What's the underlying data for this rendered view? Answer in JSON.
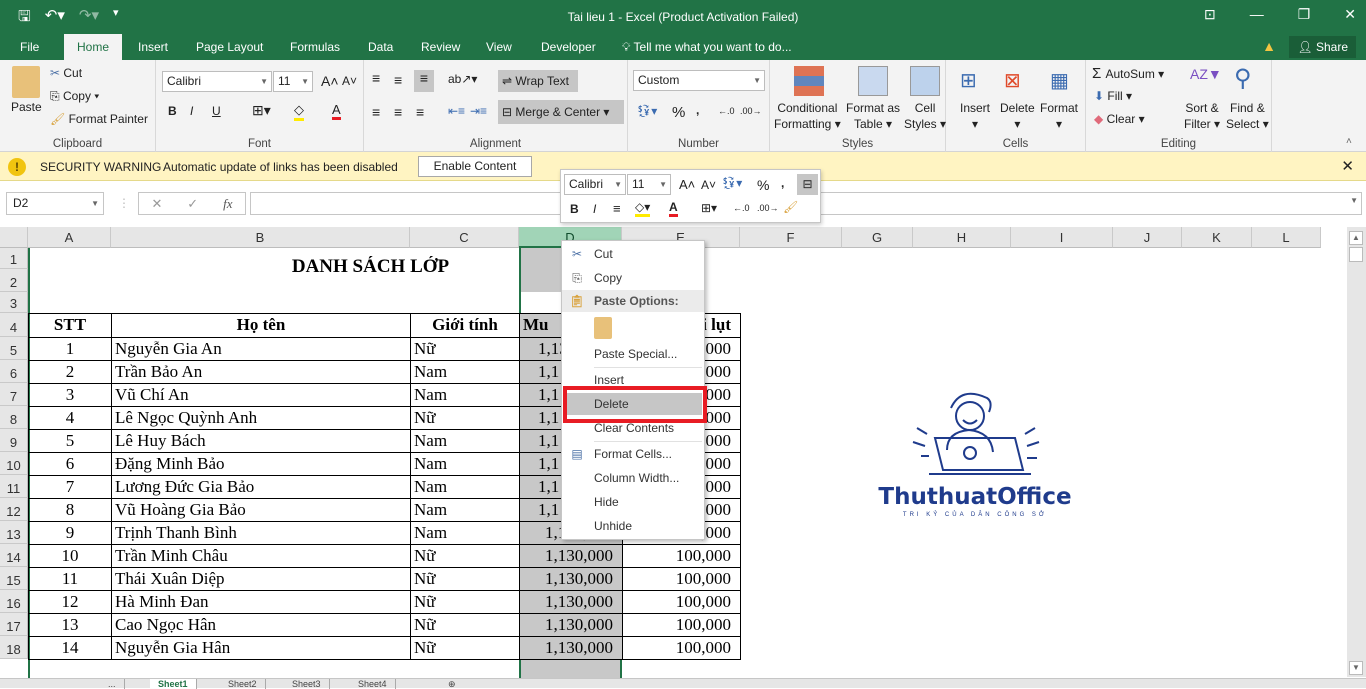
{
  "window": {
    "title": "Tai lieu 1 - Excel (Product Activation Failed)"
  },
  "qat": {
    "save": "save-icon",
    "undo": "undo-icon",
    "redo": "redo-icon",
    "customize": "customize-icon"
  },
  "tabs": [
    {
      "label": "File"
    },
    {
      "label": "Home"
    },
    {
      "label": "Insert"
    },
    {
      "label": "Page Layout"
    },
    {
      "label": "Formulas"
    },
    {
      "label": "Data"
    },
    {
      "label": "Review"
    },
    {
      "label": "View"
    },
    {
      "label": "Developer"
    }
  ],
  "tell_me": "Tell me what you want to do...",
  "share": "Share",
  "ribbon": {
    "clipboard": {
      "label": "Clipboard",
      "paste": "Paste",
      "cut": "Cut",
      "copy": "Copy",
      "format_painter": "Format Painter"
    },
    "font": {
      "label": "Font",
      "name": "Calibri",
      "size": "11",
      "bold": "B",
      "italic": "I",
      "underline": "U"
    },
    "alignment": {
      "label": "Alignment",
      "wrap": "Wrap Text",
      "merge": "Merge & Center"
    },
    "number": {
      "label": "Number",
      "format": "Custom",
      "percent": "%",
      "comma": ","
    },
    "styles": {
      "label": "Styles",
      "conditional": "Conditional",
      "conditional2": "Formatting",
      "format_as": "Format as",
      "table": "Table",
      "cell": "Cell",
      "cell_styles": "Styles"
    },
    "cells": {
      "label": "Cells",
      "insert": "Insert",
      "delete": "Delete",
      "format": "Format"
    },
    "editing": {
      "label": "Editing",
      "autosum": "AutoSum",
      "fill": "Fill",
      "clear": "Clear",
      "sort": "Sort &",
      "filter": "Filter",
      "find": "Find &",
      "select": "Select"
    }
  },
  "security": {
    "title": "SECURITY WARNING",
    "message": "Automatic update of links has been disabled",
    "button": "Enable Content"
  },
  "formula_bar": {
    "name_box": "D2",
    "fx": "fx",
    "value": ""
  },
  "columns": [
    "A",
    "B",
    "C",
    "D",
    "E",
    "F",
    "G",
    "H",
    "I",
    "J",
    "K",
    "L"
  ],
  "rows": [
    "1",
    "2",
    "3",
    "4",
    "5",
    "6",
    "7",
    "8",
    "9",
    "10",
    "11",
    "12",
    "13",
    "14",
    "15",
    "16",
    "17",
    "18"
  ],
  "sheet": {
    "title": "DANH SÁCH LỚP",
    "headers": {
      "stt": "STT",
      "name": "Họ tên",
      "gender": "Giới tính",
      "d": "Mu",
      "e": "i lụt"
    },
    "records": [
      {
        "stt": "1",
        "name": "Nguyễn Gia An",
        "gender": "Nữ",
        "d": "1,13",
        "e": "100,000"
      },
      {
        "stt": "2",
        "name": "Trần Bảo An",
        "gender": "Nam",
        "d": "1,1",
        "e": "100,000"
      },
      {
        "stt": "3",
        "name": "Vũ Chí An",
        "gender": "Nam",
        "d": "1,1",
        "e": "100,000"
      },
      {
        "stt": "4",
        "name": "Lê Ngọc Quỳnh Anh",
        "gender": "Nữ",
        "d": "1,1",
        "e": "100,000"
      },
      {
        "stt": "5",
        "name": "Lê Huy Bách",
        "gender": "Nam",
        "d": "1,1",
        "e": "100,000"
      },
      {
        "stt": "6",
        "name": "Đặng Minh Bảo",
        "gender": "Nam",
        "d": "1,1",
        "e": "100,000"
      },
      {
        "stt": "7",
        "name": "Lương Đức Gia Bảo",
        "gender": "Nam",
        "d": "1,1",
        "e": "100,000"
      },
      {
        "stt": "8",
        "name": "Vũ Hoàng Gia Bảo",
        "gender": "Nam",
        "d": "1,1",
        "e": "100,000"
      },
      {
        "stt": "9",
        "name": "Trịnh Thanh Bình",
        "gender": "Nam",
        "d": "1,130,000",
        "e": "100,000"
      },
      {
        "stt": "10",
        "name": "Trần Minh Châu",
        "gender": "Nữ",
        "d": "1,130,000",
        "e": "100,000"
      },
      {
        "stt": "11",
        "name": "Thái Xuân Diệp",
        "gender": "Nữ",
        "d": "1,130,000",
        "e": "100,000"
      },
      {
        "stt": "12",
        "name": "Hà Minh Đan",
        "gender": "Nữ",
        "d": "1,130,000",
        "e": "100,000"
      },
      {
        "stt": "13",
        "name": "Cao Ngọc Hân",
        "gender": "Nữ",
        "d": "1,130,000",
        "e": "100,000"
      },
      {
        "stt": "14",
        "name": "Nguyễn Gia Hân",
        "gender": "Nữ",
        "d": "1,130,000",
        "e": "100,000"
      }
    ]
  },
  "mini_toolbar": {
    "font": "Calibri",
    "size": "11",
    "percent": "%",
    "comma": ",",
    "bold": "B",
    "italic": "I"
  },
  "context_menu": {
    "cut": "Cut",
    "copy": "Copy",
    "paste_options": "Paste Options:",
    "paste_special": "Paste Special...",
    "insert": "Insert",
    "delete": "Delete",
    "clear": "Clear Contents",
    "format_cells": "Format Cells...",
    "column_width": "Column Width...",
    "hide": "Hide",
    "unhide": "Unhide"
  },
  "logo": {
    "brand": "ThuthuatOffice",
    "tagline": "TRI KỶ CỦA DÂN CÔNG SỞ",
    "color": "#1f3b8c"
  },
  "sheet_tabs": [
    "...",
    "Sheet1",
    "Sheet2",
    "Sheet3",
    "Sheet4"
  ],
  "colors": {
    "excel_green": "#217346",
    "highlight_red": "#e81c24",
    "warning_bg": "#fff4c2"
  }
}
